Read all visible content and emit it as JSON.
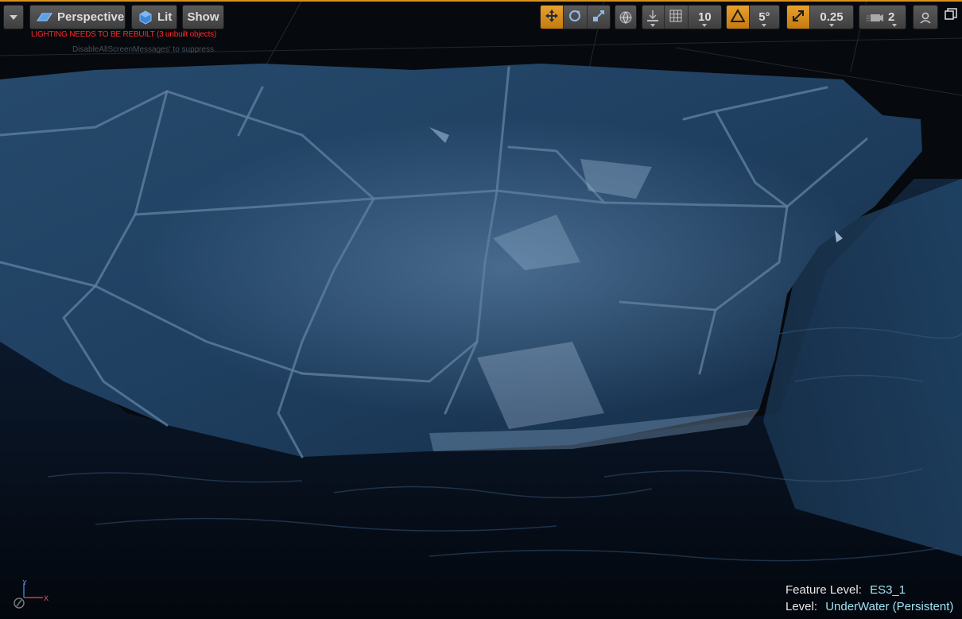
{
  "toolbar": {
    "menu_icon": "chevron-down-icon",
    "perspective_label": "Perspective",
    "lit_label": "Lit",
    "show_label": "Show",
    "grid_snap_value": "10",
    "rotation_snap_value": "5°",
    "scale_snap_value": "0.25",
    "camera_speed_value": "2"
  },
  "viewport": {
    "warning_text": "LIGHTING NEEDS TO BE REBUILT (3 unbuilt objects)",
    "secondary_message": "DisableAllScreenMessages' to suppress"
  },
  "info": {
    "feature_level_label": "Feature Level:",
    "feature_level_value": "ES3_1",
    "level_label": "Level:",
    "level_value": "UnderWater (Persistent)"
  },
  "colors": {
    "accent": "#e8a02c",
    "warning": "#ff2a2a",
    "level_value": "#9fe3f2"
  }
}
